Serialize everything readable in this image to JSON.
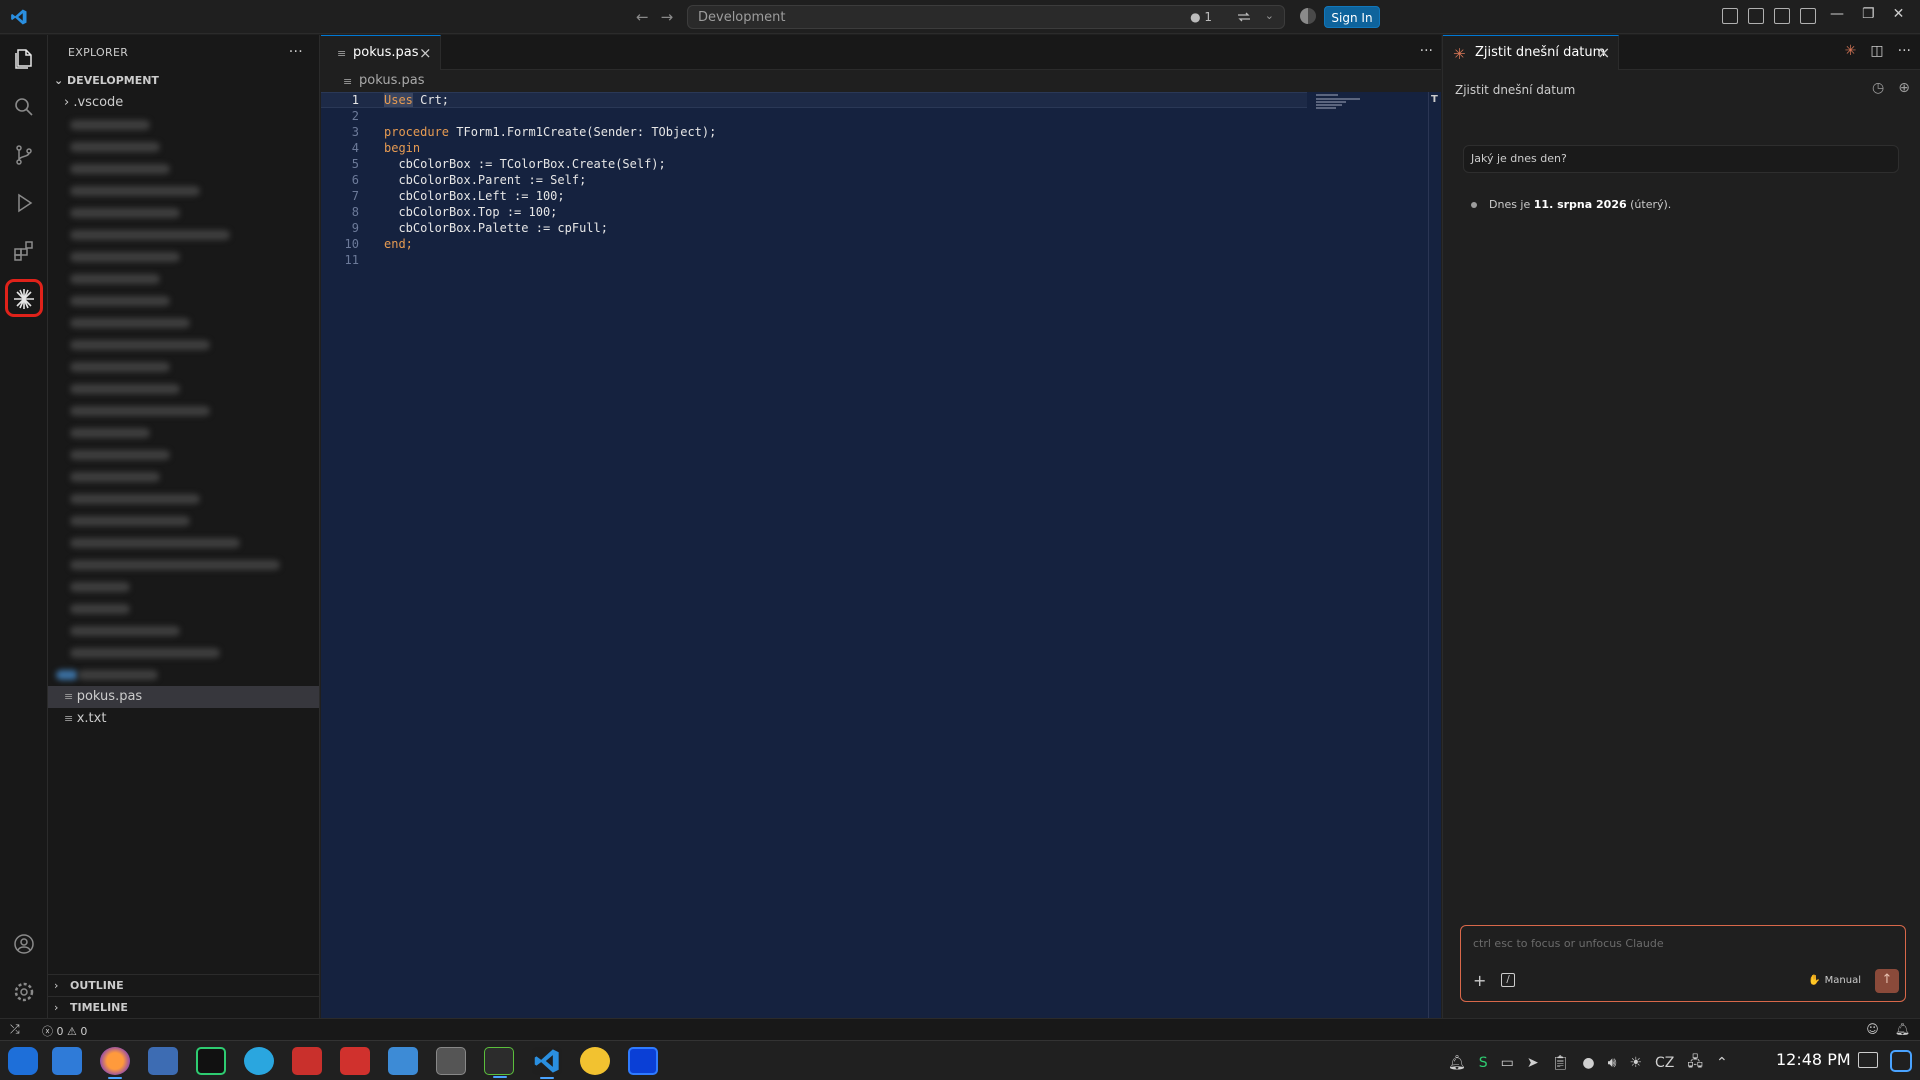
{
  "titlebar": {
    "search_text": "Development",
    "badge_text": "● 1",
    "sign_in_label": "Sign In"
  },
  "sidebar": {
    "title": "EXPLORER",
    "root_label": "DEVELOPMENT",
    "items": [
      {
        "label": ".vscode",
        "type": "folder"
      },
      {
        "label": "pokus.pas",
        "type": "file",
        "selected": true
      },
      {
        "label": "x.txt",
        "type": "file"
      }
    ],
    "outline_label": "OUTLINE",
    "timeline_label": "TIMELINE"
  },
  "editor": {
    "tab_label": "pokus.pas",
    "breadcrumb": "pokus.pas",
    "lines": [
      {
        "n": "1",
        "tokens": [
          {
            "t": "Uses",
            "c": "kw-hl"
          },
          {
            "t": " Crt;",
            "c": "id"
          }
        ]
      },
      {
        "n": "2",
        "tokens": []
      },
      {
        "n": "3",
        "tokens": [
          {
            "t": "procedure",
            "c": "kw"
          },
          {
            "t": " TForm1.Form1Create(Sender: TObject);",
            "c": "id"
          }
        ]
      },
      {
        "n": "4",
        "tokens": [
          {
            "t": "begin",
            "c": "kw"
          }
        ]
      },
      {
        "n": "5",
        "tokens": [
          {
            "t": "  cbColorBox := TColorBox.Create(Self);",
            "c": "id"
          }
        ]
      },
      {
        "n": "6",
        "tokens": [
          {
            "t": "  cbColorBox.Parent := Self;",
            "c": "id"
          }
        ]
      },
      {
        "n": "7",
        "tokens": [
          {
            "t": "  cbColorBox.Left := 100;",
            "c": "id"
          }
        ]
      },
      {
        "n": "8",
        "tokens": [
          {
            "t": "  cbColorBox.Top := 100;",
            "c": "id"
          }
        ]
      },
      {
        "n": "9",
        "tokens": [
          {
            "t": "  cbColorBox.Palette := cpFull;",
            "c": "id"
          }
        ]
      },
      {
        "n": "10",
        "tokens": [
          {
            "t": "end;",
            "c": "kw"
          }
        ]
      },
      {
        "n": "11",
        "tokens": []
      }
    ]
  },
  "chat": {
    "tab_label": "Zjistit dnešní datum",
    "header_title": "Zjistit dnešní datum",
    "user_message": "Jaký je dnes den?",
    "answer_prefix": "Dnes je ",
    "answer_bold": "11. srpna 2026",
    "answer_suffix": " (úterý).",
    "input_placeholder": "ctrl esc to focus or unfocus Claude",
    "mode_label": "Manual"
  },
  "statusbar": {
    "errors": "0",
    "warnings": "0"
  },
  "taskbar": {
    "clock": "12:48 PM",
    "keyboard_layout": "CZ"
  },
  "colors": {
    "accent": "#0078d4",
    "claude": "#d97757",
    "editor_bg": "#15223f",
    "keyword": "#e69b52",
    "highlight_ring": "#e0221a"
  }
}
